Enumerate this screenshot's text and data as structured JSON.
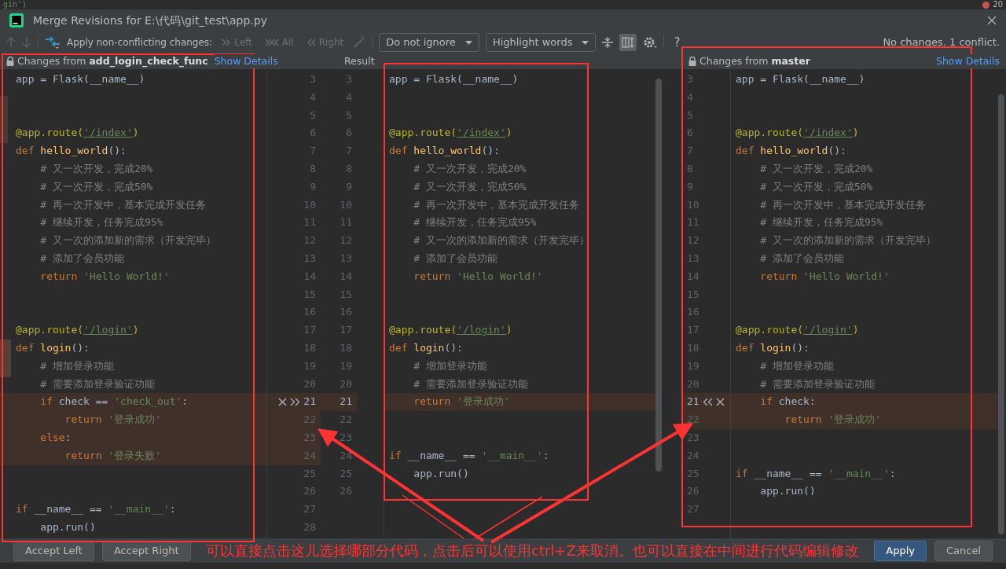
{
  "background_editor": {
    "code": "gin')",
    "badge": "20"
  },
  "window": {
    "title": "Merge Revisions for E:\\代码\\git_test\\app.py"
  },
  "toolbar": {
    "apply_label": "Apply non-conflicting changes:",
    "apply_buttons": [
      {
        "label": "Left",
        "disabled": true
      },
      {
        "label": "All",
        "disabled": true
      },
      {
        "label": "Right",
        "disabled": true
      }
    ],
    "dropdowns": [
      {
        "label": "Do not ignore"
      },
      {
        "label": "Highlight words"
      }
    ],
    "sync_scroll_on": true,
    "help": "?",
    "status": "No changes. 1 conflict."
  },
  "headers": {
    "left": {
      "title": "Changes from **add_login_check_func**",
      "link": "Show Details"
    },
    "result": {
      "title": "Result"
    },
    "right": {
      "title": "Changes from **master**",
      "link": "Show Details"
    }
  },
  "left_pane": {
    "lines": [
      {
        "number": "3",
        "changed": false,
        "code": [
          {
            "kind": "plain",
            "text": "app = Flask(__name__)"
          }
        ]
      },
      {
        "number": "4",
        "changed": false
      },
      {
        "number": "5",
        "changed": false
      },
      {
        "number": "6",
        "changed": false,
        "code": [
          {
            "kind": "decorator",
            "text": "@app.route("
          },
          {
            "kind": "link",
            "text": "'/index'"
          },
          {
            "kind": "decorator",
            "text": ")"
          }
        ]
      },
      {
        "number": "7",
        "changed": false,
        "code": [
          {
            "kind": "keyword",
            "text": "def "
          },
          {
            "kind": "function",
            "text": "hello_world"
          },
          {
            "kind": "plain",
            "text": "():"
          }
        ]
      },
      {
        "number": "8",
        "changed": false,
        "code": [
          {
            "kind": "comment",
            "text": "    # 又一次开发，完成20%"
          }
        ]
      },
      {
        "number": "9",
        "changed": false,
        "code": [
          {
            "kind": "comment",
            "text": "    # 又一次开发，完成50%"
          }
        ]
      },
      {
        "number": "10",
        "changed": false,
        "code": [
          {
            "kind": "comment",
            "text": "    # 再一次开发中，基本完成开发任务"
          }
        ]
      },
      {
        "number": "11",
        "changed": false,
        "code": [
          {
            "kind": "comment",
            "text": "    # 继续开发，任务完成95%"
          }
        ]
      },
      {
        "number": "12",
        "changed": false,
        "code": [
          {
            "kind": "comment",
            "text": "    # 又一次的添加新的需求（开发完毕）"
          }
        ]
      },
      {
        "number": "13",
        "changed": false,
        "code": [
          {
            "kind": "comment",
            "text": "    # 添加了会员功能"
          }
        ]
      },
      {
        "number": "14",
        "changed": false,
        "code": [
          {
            "kind": "keyword",
            "text": "    return "
          },
          {
            "kind": "string",
            "text": "'Hello World!'"
          }
        ]
      },
      {
        "number": "15",
        "changed": false
      },
      {
        "number": "16",
        "changed": false
      },
      {
        "number": "17",
        "changed": false,
        "code": [
          {
            "kind": "decorator",
            "text": "@app.route("
          },
          {
            "kind": "link",
            "text": "'/login'"
          },
          {
            "kind": "decorator",
            "text": ")"
          }
        ]
      },
      {
        "number": "18",
        "changed": false,
        "code": [
          {
            "kind": "keyword",
            "text": "def "
          },
          {
            "kind": "function",
            "text": "login"
          },
          {
            "kind": "plain",
            "text": "():"
          }
        ]
      },
      {
        "number": "19",
        "changed": false,
        "code": [
          {
            "kind": "comment",
            "text": "    # 增加登录功能"
          }
        ]
      },
      {
        "number": "20",
        "changed": false,
        "code": [
          {
            "kind": "comment",
            "text": "    # 需要添加登录验证功能"
          }
        ]
      },
      {
        "number": "21",
        "changed": true,
        "code": [
          {
            "kind": "keyword",
            "text": "    if "
          },
          {
            "kind": "plain",
            "text": "check == "
          },
          {
            "kind": "string",
            "text": "'check_out'"
          },
          {
            "kind": "plain",
            "text": ":"
          }
        ]
      },
      {
        "number": "22",
        "changed": true,
        "code": [
          {
            "kind": "keyword",
            "text": "        return "
          },
          {
            "kind": "string",
            "text": "'登录成功'"
          }
        ]
      },
      {
        "number": "23",
        "changed": true,
        "code": [
          {
            "kind": "keyword",
            "text": "    else"
          },
          {
            "kind": "plain",
            "text": ":"
          }
        ]
      },
      {
        "number": "24",
        "changed": true,
        "code": [
          {
            "kind": "keyword",
            "text": "        return "
          },
          {
            "kind": "string",
            "text": "'登录失败'"
          }
        ]
      },
      {
        "number": "25",
        "changed": false
      },
      {
        "number": "26",
        "changed": false
      },
      {
        "number": "27",
        "changed": false,
        "code": [
          {
            "kind": "keyword",
            "text": "if "
          },
          {
            "kind": "plain",
            "text": "__name__ == "
          },
          {
            "kind": "string",
            "text": "'__main__'"
          },
          {
            "kind": "plain",
            "text": ":"
          }
        ]
      },
      {
        "number": "28",
        "changed": false,
        "code": [
          {
            "kind": "plain",
            "text": "    app.run()"
          }
        ]
      }
    ]
  },
  "result_pane": {
    "lines": [
      {
        "number": "3",
        "changed": false,
        "code": [
          {
            "kind": "plain",
            "text": "app = Flask(__name__)"
          }
        ]
      },
      {
        "number": "4",
        "changed": false
      },
      {
        "number": "5",
        "changed": false
      },
      {
        "number": "6",
        "changed": false,
        "code": [
          {
            "kind": "decorator",
            "text": "@app.route("
          },
          {
            "kind": "link",
            "text": "'/index'"
          },
          {
            "kind": "decorator",
            "text": ")"
          }
        ]
      },
      {
        "number": "7",
        "changed": false,
        "code": [
          {
            "kind": "keyword",
            "text": "def "
          },
          {
            "kind": "function",
            "text": "hello_world"
          },
          {
            "kind": "plain",
            "text": "():"
          }
        ]
      },
      {
        "number": "8",
        "changed": false,
        "code": [
          {
            "kind": "comment",
            "text": "    # 又一次开发，完成20%"
          }
        ]
      },
      {
        "number": "9",
        "changed": false,
        "code": [
          {
            "kind": "comment",
            "text": "    # 又一次开发，完成50%"
          }
        ]
      },
      {
        "number": "10",
        "changed": false,
        "code": [
          {
            "kind": "comment",
            "text": "    # 再一次开发中，基本完成开发任务"
          }
        ]
      },
      {
        "number": "11",
        "changed": false,
        "code": [
          {
            "kind": "comment",
            "text": "    # 继续开发，任务完成95%"
          }
        ]
      },
      {
        "number": "12",
        "changed": false,
        "code": [
          {
            "kind": "comment",
            "text": "    # 又一次的添加新的需求（开发完毕）"
          }
        ]
      },
      {
        "number": "13",
        "changed": false,
        "code": [
          {
            "kind": "comment",
            "text": "    # 添加了会员功能"
          }
        ]
      },
      {
        "number": "14",
        "changed": false,
        "code": [
          {
            "kind": "keyword",
            "text": "    return "
          },
          {
            "kind": "string",
            "text": "'Hello World!'"
          }
        ]
      },
      {
        "number": "15",
        "changed": false
      },
      {
        "number": "16",
        "changed": false
      },
      {
        "number": "17",
        "changed": false,
        "code": [
          {
            "kind": "decorator",
            "text": "@app.route("
          },
          {
            "kind": "link",
            "text": "'/login'"
          },
          {
            "kind": "decorator",
            "text": ")"
          }
        ]
      },
      {
        "number": "18",
        "changed": false,
        "code": [
          {
            "kind": "keyword",
            "text": "def "
          },
          {
            "kind": "function",
            "text": "login"
          },
          {
            "kind": "plain",
            "text": "():"
          }
        ]
      },
      {
        "number": "19",
        "changed": false,
        "code": [
          {
            "kind": "comment",
            "text": "    # 增加登录功能"
          }
        ]
      },
      {
        "number": "20",
        "changed": false,
        "code": [
          {
            "kind": "comment",
            "text": "    # 需要添加登录验证功能"
          }
        ]
      },
      {
        "number": "21",
        "changed": true,
        "code": [
          {
            "kind": "keyword",
            "text": "    return "
          },
          {
            "kind": "string",
            "text": "'登录成功'"
          }
        ]
      },
      {
        "number": "22",
        "changed": false
      },
      {
        "number": "23",
        "changed": false
      },
      {
        "number": "24",
        "changed": false,
        "code": [
          {
            "kind": "keyword",
            "text": "if "
          },
          {
            "kind": "plain",
            "text": "__name__ == "
          },
          {
            "kind": "string",
            "text": "'__main__'"
          },
          {
            "kind": "plain",
            "text": ":"
          }
        ]
      },
      {
        "number": "25",
        "changed": false,
        "code": [
          {
            "kind": "plain",
            "text": "    app.run()"
          }
        ]
      },
      {
        "number": "26",
        "changed": false
      }
    ]
  },
  "right_pane": {
    "lines": [
      {
        "number": "3",
        "changed": false,
        "code": [
          {
            "kind": "plain",
            "text": "app = Flask(__name__)"
          }
        ]
      },
      {
        "number": "4",
        "changed": false
      },
      {
        "number": "5",
        "changed": false
      },
      {
        "number": "6",
        "changed": false,
        "code": [
          {
            "kind": "decorator",
            "text": "@app.route("
          },
          {
            "kind": "link",
            "text": "'/index'"
          },
          {
            "kind": "decorator",
            "text": ")"
          }
        ]
      },
      {
        "number": "7",
        "changed": false,
        "code": [
          {
            "kind": "keyword",
            "text": "def "
          },
          {
            "kind": "function",
            "text": "hello_world"
          },
          {
            "kind": "plain",
            "text": "():"
          }
        ]
      },
      {
        "number": "8",
        "changed": false,
        "code": [
          {
            "kind": "comment",
            "text": "    # 又一次开发，完成20%"
          }
        ]
      },
      {
        "number": "9",
        "changed": false,
        "code": [
          {
            "kind": "comment",
            "text": "    # 又一次开发，完成50%"
          }
        ]
      },
      {
        "number": "10",
        "changed": false,
        "code": [
          {
            "kind": "comment",
            "text": "    # 再一次开发中，基本完成开发任务"
          }
        ]
      },
      {
        "number": "11",
        "changed": false,
        "code": [
          {
            "kind": "comment",
            "text": "    # 继续开发，任务完成95%"
          }
        ]
      },
      {
        "number": "12",
        "changed": false,
        "code": [
          {
            "kind": "comment",
            "text": "    # 又一次的添加新的需求（开发完毕）"
          }
        ]
      },
      {
        "number": "13",
        "changed": false,
        "code": [
          {
            "kind": "comment",
            "text": "    # 添加了会员功能"
          }
        ]
      },
      {
        "number": "14",
        "changed": false,
        "code": [
          {
            "kind": "keyword",
            "text": "    return "
          },
          {
            "kind": "string",
            "text": "'Hello World!'"
          }
        ]
      },
      {
        "number": "15",
        "changed": false
      },
      {
        "number": "16",
        "changed": false
      },
      {
        "number": "17",
        "changed": false,
        "code": [
          {
            "kind": "decorator",
            "text": "@app.route("
          },
          {
            "kind": "link",
            "text": "'/login'"
          },
          {
            "kind": "decorator",
            "text": ")"
          }
        ]
      },
      {
        "number": "18",
        "changed": false,
        "code": [
          {
            "kind": "keyword",
            "text": "def "
          },
          {
            "kind": "function",
            "text": "login"
          },
          {
            "kind": "plain",
            "text": "():"
          }
        ]
      },
      {
        "number": "19",
        "changed": false,
        "code": [
          {
            "kind": "comment",
            "text": "    # 增加登录功能"
          }
        ]
      },
      {
        "number": "20",
        "changed": false,
        "code": [
          {
            "kind": "comment",
            "text": "    # 需要添加登录验证功能"
          }
        ]
      },
      {
        "number": "21",
        "changed": true,
        "code": [
          {
            "kind": "keyword",
            "text": "    if "
          },
          {
            "kind": "plain",
            "text": "check:"
          }
        ]
      },
      {
        "number": "22",
        "changed": true,
        "code": [
          {
            "kind": "keyword",
            "text": "        return "
          },
          {
            "kind": "string",
            "text": "'登录成功'"
          }
        ]
      },
      {
        "number": "23",
        "changed": false
      },
      {
        "number": "24",
        "changed": false
      },
      {
        "number": "25",
        "changed": false,
        "code": [
          {
            "kind": "keyword",
            "text": "if "
          },
          {
            "kind": "plain",
            "text": "__name__ == "
          },
          {
            "kind": "string",
            "text": "'__main__'"
          },
          {
            "kind": "plain",
            "text": ":"
          }
        ]
      },
      {
        "number": "26",
        "changed": false,
        "code": [
          {
            "kind": "plain",
            "text": "    app.run()"
          }
        ]
      },
      {
        "number": "27",
        "changed": false
      }
    ]
  },
  "buttons": [
    {
      "label": "Accept Left",
      "kind": "secondary"
    },
    {
      "label": "Accept Right",
      "kind": "secondary"
    },
    {
      "label": "Apply",
      "kind": "primary"
    },
    {
      "label": "Cancel",
      "kind": "secondary"
    }
  ],
  "annotation": {
    "text": "可以直接点击这儿选择哪部分代码，点击后可以使用ctrl+Z来取消。也可以直接在中间进行代码编辑修改"
  }
}
